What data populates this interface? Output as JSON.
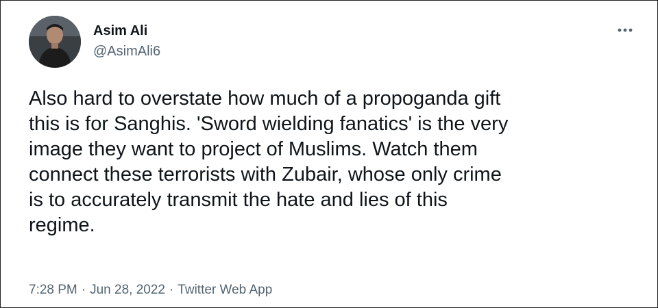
{
  "author": {
    "display_name": "Asim Ali",
    "handle": "@AsimAli6"
  },
  "more_icon": "ellipsis-icon",
  "tweet": {
    "lines": [
      "Also hard to overstate how much of a propoganda gift",
      "this is for Sanghis. 'Sword wielding fanatics' is the very",
      "image they want to project of Muslims. Watch them",
      "connect these terrorists with Zubair, whose only crime",
      "is to accurately transmit the hate and lies of this",
      "regime."
    ]
  },
  "meta": {
    "time": "7:28 PM",
    "separator": "·",
    "date": "Jun 28, 2022",
    "source": "Twitter Web App"
  },
  "colors": {
    "text_primary": "#0f1419",
    "text_secondary": "#536471",
    "border": "#1f1f1f"
  }
}
